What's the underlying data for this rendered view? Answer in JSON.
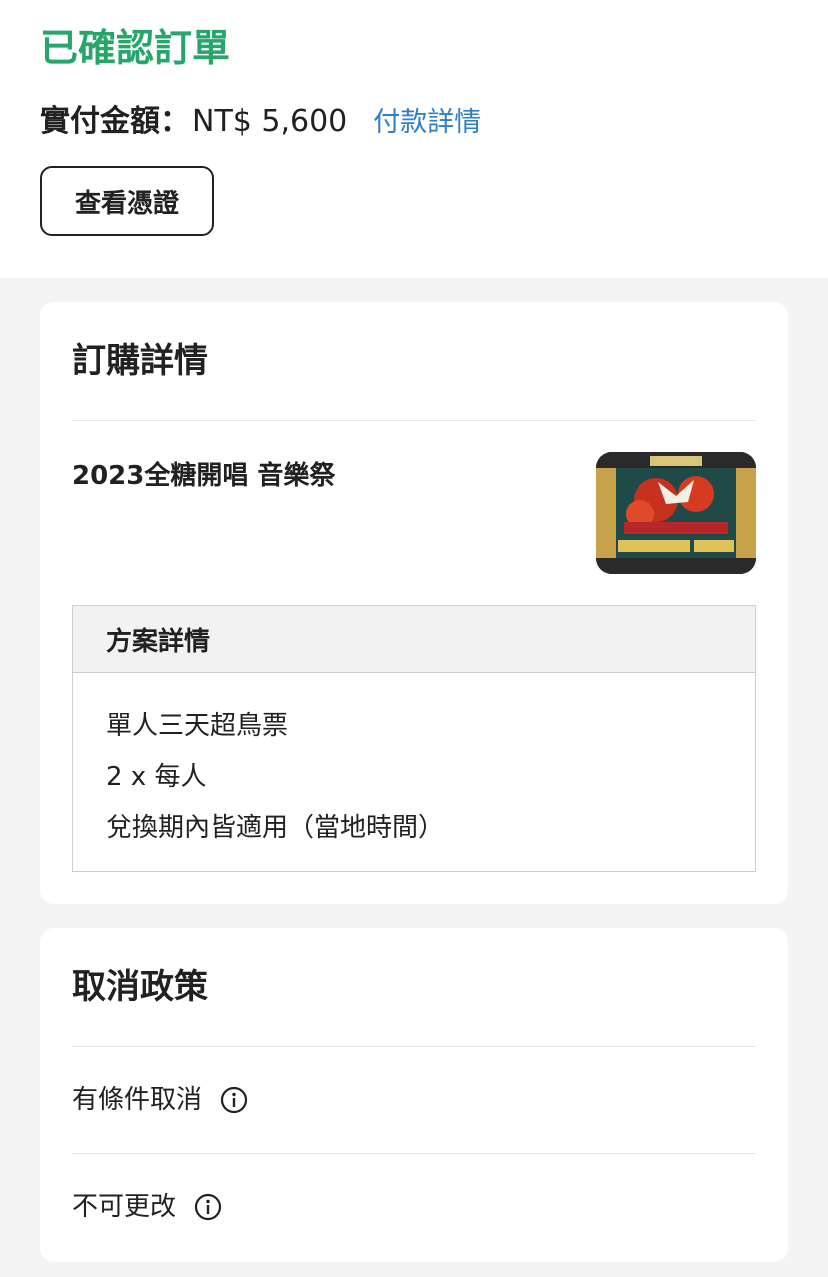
{
  "header": {
    "status": "已確認訂單",
    "amount_label": "實付金額：",
    "amount_value": "NT$ 5,600",
    "payment_details_link": "付款詳情",
    "view_voucher_button": "查看憑證"
  },
  "order_details": {
    "title": "訂購詳情",
    "product_name": "2023全糖開唱 音樂祭",
    "plan": {
      "title": "方案詳情",
      "lines": [
        "單人三天超鳥票",
        "2 x 每人",
        "兌換期內皆適用（當地時間）"
      ]
    }
  },
  "cancellation": {
    "title": "取消政策",
    "items": [
      {
        "label": "有條件取消",
        "icon": "info-icon"
      },
      {
        "label": "不可更改",
        "icon": "info-icon"
      }
    ]
  },
  "colors": {
    "status_green": "#26a66b",
    "link_blue": "#2f7fc8"
  }
}
